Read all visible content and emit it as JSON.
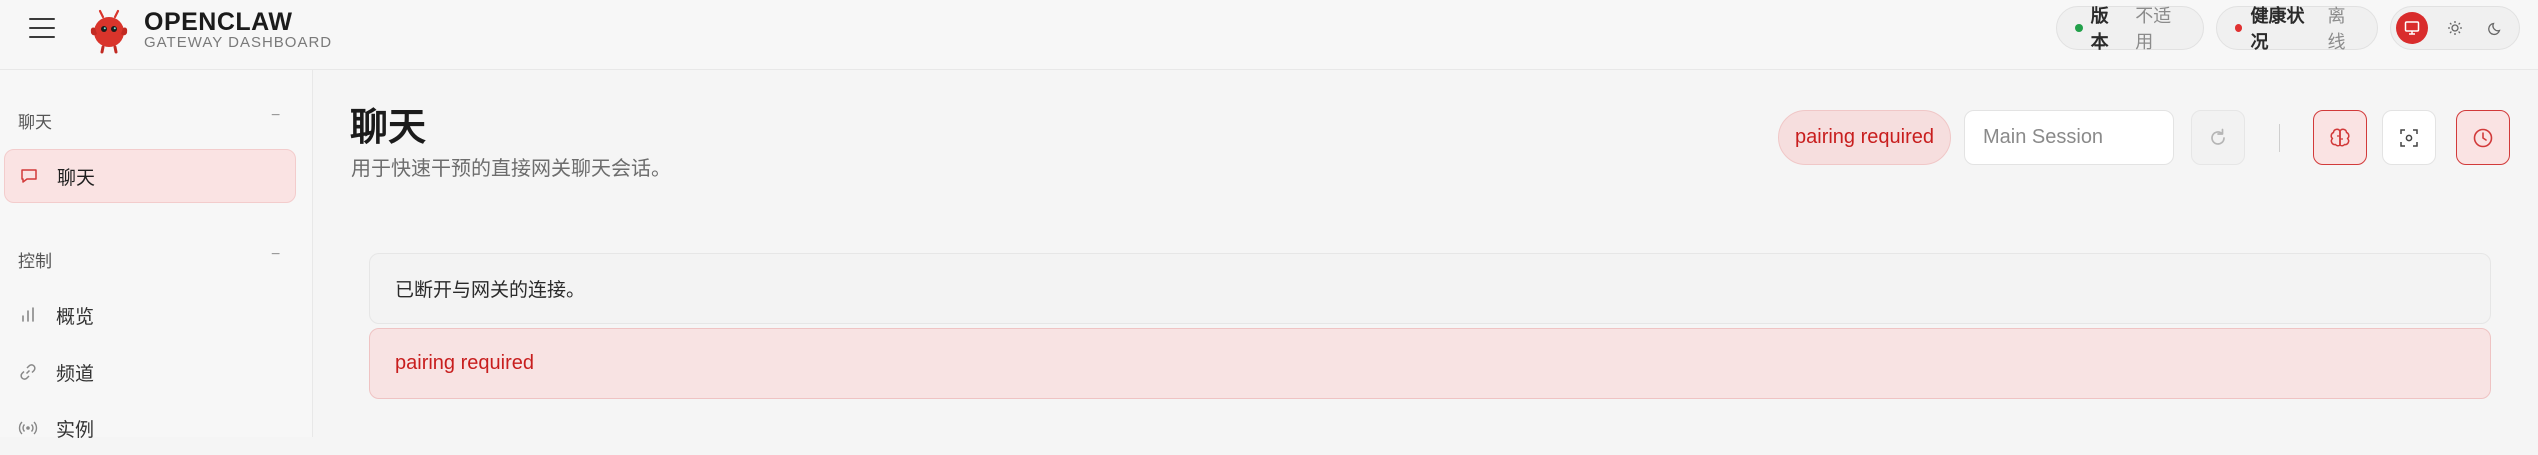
{
  "brand": {
    "title": "OPENCLAW",
    "subtitle": "GATEWAY DASHBOARD"
  },
  "header": {
    "version": {
      "label": "版本",
      "value": "不适用",
      "dot_color": "#22a04a"
    },
    "health": {
      "label": "健康状况",
      "value": "离线",
      "dot_color": "#e03131"
    },
    "theme_options": [
      "monitor-icon",
      "sun-icon",
      "moon-icon"
    ],
    "theme_selected": "monitor-icon"
  },
  "sidebar": {
    "sections": [
      {
        "title": "聊天",
        "toggle": "−",
        "items": [
          {
            "label": "聊天",
            "icon": "chat-bubble-icon",
            "active": true
          }
        ]
      },
      {
        "title": "控制",
        "toggle": "−",
        "items": [
          {
            "label": "概览",
            "icon": "bar-chart-icon"
          },
          {
            "label": "频道",
            "icon": "link-icon"
          },
          {
            "label": "实例",
            "icon": "broadcast-icon"
          }
        ]
      }
    ]
  },
  "page": {
    "title": "聊天",
    "subtitle": "用于快速干预的直接网关聊天会话。",
    "status": "pairing required",
    "session_placeholder": "Main Session"
  },
  "messages": {
    "disconnected": "已断开与网关的连接。",
    "error": "pairing required"
  },
  "colors": {
    "accent": "#d92c2c",
    "error_text": "#c81e1e",
    "error_bg": "#f8e3e3"
  }
}
